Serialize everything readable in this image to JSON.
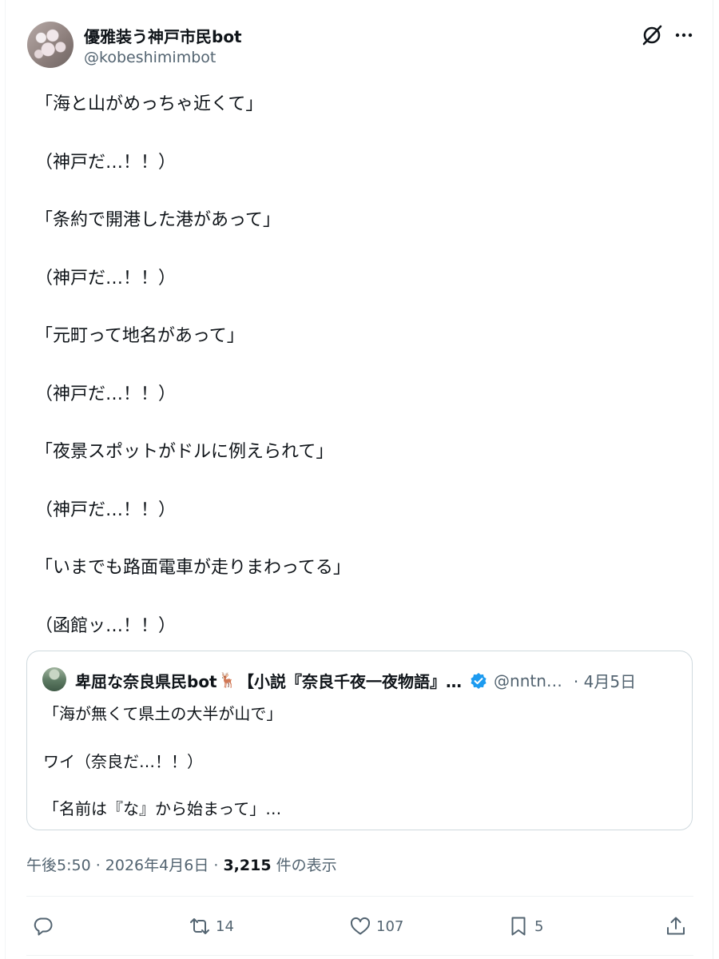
{
  "author": {
    "display_name": "優雅装う神戸市民bot",
    "handle": "@kobeshimimbot"
  },
  "icons": {
    "avatar": "cherry-blossom-avatar",
    "grok": "grok-icon",
    "more": "more-dots-icon",
    "verified": "verified-badge-icon",
    "reply": "reply-icon",
    "retweet": "retweet-icon",
    "like": "heart-icon",
    "bookmark": "bookmark-icon",
    "share": "share-icon"
  },
  "body_lines": [
    "「海と山がめっちゃ近くて」",
    "（神戸だ…！！）",
    "「条約で開港した港があって」",
    "（神戸だ…！！）",
    "「元町って地名があって」",
    "（神戸だ…！！）",
    "「夜景スポットがドルに例えられて」",
    "（神戸だ…！！）",
    "「いまでも路面電車が走りまわってる」",
    "（函館ッ…！！）"
  ],
  "quote": {
    "display_name": "卑屈な奈良県民bot",
    "deer_emoji": "🦌",
    "name_suffix": "【小説『奈良千夜一夜物語』…",
    "handle": "@nntn…",
    "date": "· 4月5日",
    "lines": [
      "「海が無くて県土の大半が山で」",
      "ワイ（奈良だ…！！）",
      "「名前は『な』から始まって」…"
    ]
  },
  "meta": {
    "time": "午後5:50",
    "separator": " · ",
    "date": "2026年4月6日",
    "views": "3,215",
    "views_label": " 件の表示"
  },
  "actions": {
    "reply_count": "",
    "retweet_count": "14",
    "like_count": "107",
    "bookmark_count": "5"
  },
  "colors": {
    "text": "#0f1419",
    "secondary": "#536471",
    "border": "#cfd9de",
    "verified": "#1d9bf0"
  }
}
